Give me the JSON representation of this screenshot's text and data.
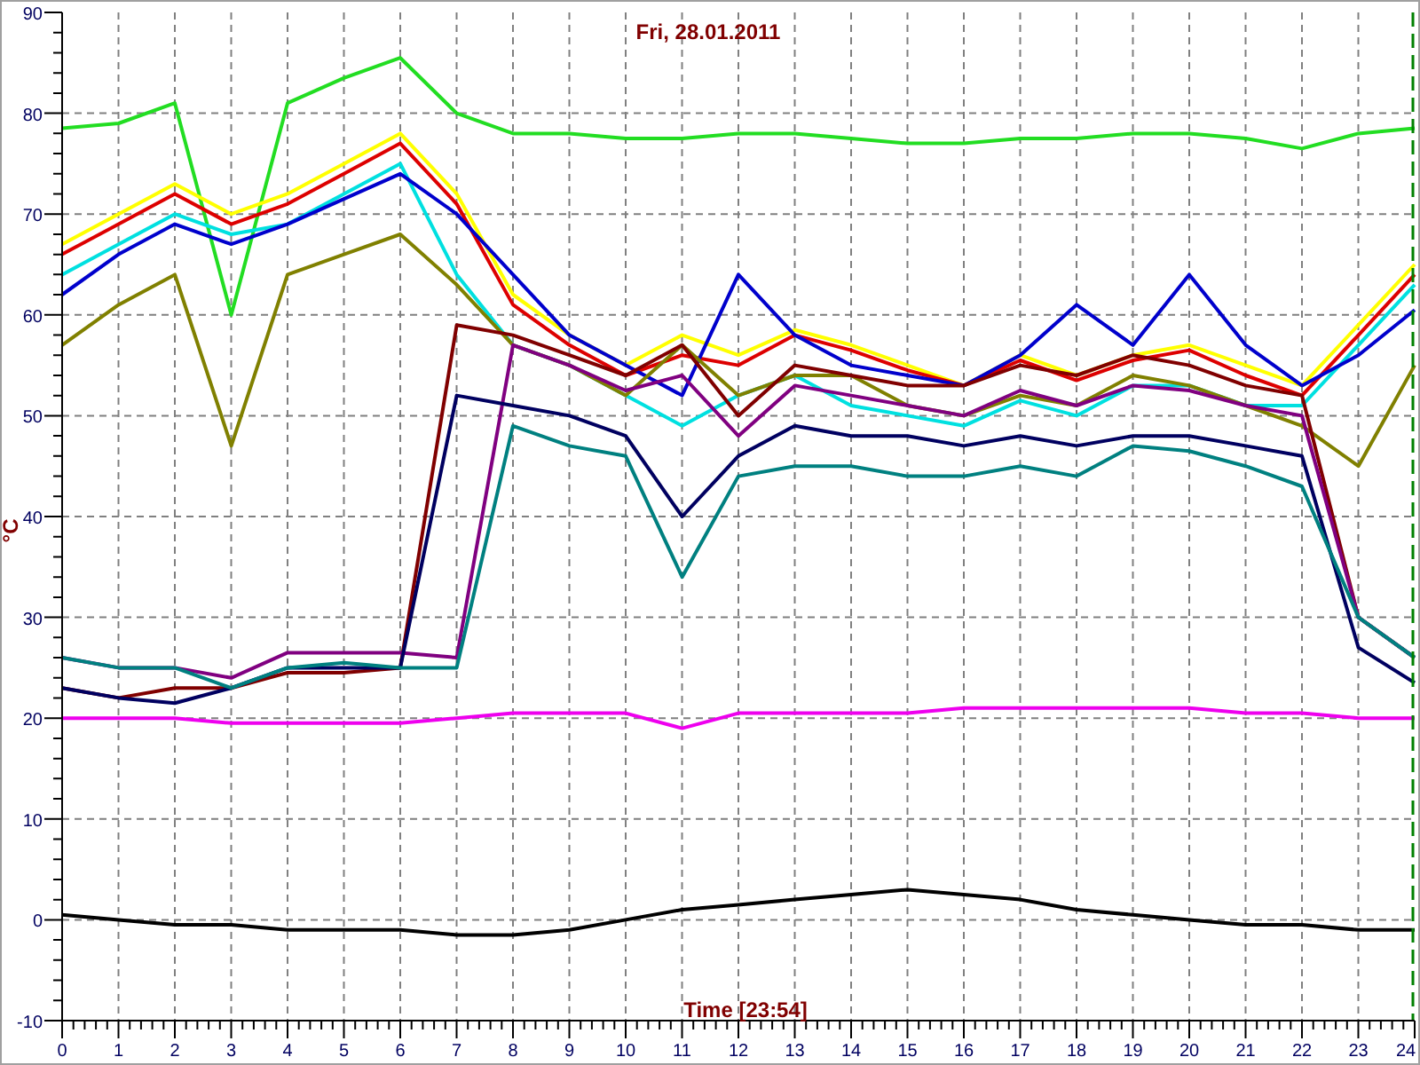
{
  "chart": {
    "chart_data": {
      "type": "line",
      "title": "Fri, 28.01.2011",
      "xlabel": "Time [23:54]",
      "ylabel": "°C",
      "x": [
        0,
        1,
        2,
        3,
        4,
        5,
        6,
        7,
        8,
        9,
        10,
        11,
        12,
        13,
        14,
        15,
        16,
        17,
        18,
        19,
        20,
        21,
        22,
        23,
        24
      ],
      "xlim": [
        0,
        24
      ],
      "ylim": [
        -10,
        90
      ],
      "xticks": [
        0,
        1,
        2,
        3,
        4,
        5,
        6,
        7,
        8,
        9,
        10,
        11,
        12,
        13,
        14,
        15,
        16,
        17,
        18,
        19,
        20,
        21,
        22,
        23,
        24
      ],
      "yticks": [
        -10,
        0,
        10,
        20,
        30,
        40,
        50,
        60,
        70,
        80,
        90
      ],
      "series": [
        {
          "color": "#22dd22",
          "values": [
            78.5,
            79,
            81,
            60,
            81,
            83.5,
            85.5,
            80,
            78,
            78,
            77.5,
            77.5,
            78,
            78,
            77.5,
            77,
            77,
            77.5,
            77.5,
            78,
            78,
            77.5,
            76.5,
            78,
            78.5
          ]
        },
        {
          "color": "#ffff00",
          "values": [
            67,
            70,
            73,
            70,
            72,
            75,
            78,
            72,
            62,
            58,
            55,
            58,
            56,
            58.5,
            57,
            55,
            53,
            56,
            54,
            56,
            57,
            55,
            53,
            59,
            65
          ]
        },
        {
          "color": "#dd0000",
          "values": [
            66,
            69,
            72,
            69,
            71,
            74,
            77,
            71,
            61,
            57,
            54,
            56,
            55,
            58,
            56.5,
            54.5,
            53,
            55.5,
            53.5,
            55.5,
            56.5,
            54,
            52,
            58,
            64
          ]
        },
        {
          "color": "#00e0e0",
          "values": [
            64,
            67,
            70,
            68,
            69,
            72,
            75,
            64,
            57,
            55,
            52,
            49,
            52,
            54,
            51,
            50,
            49,
            51.5,
            50,
            53,
            53,
            51,
            51,
            57,
            63
          ]
        },
        {
          "color": "#0000cc",
          "values": [
            62,
            66,
            69,
            67,
            69,
            71.5,
            74,
            70,
            64,
            58,
            55,
            52,
            64,
            58,
            55,
            54,
            53,
            56,
            61,
            57,
            64,
            57,
            53,
            56,
            60.5
          ]
        },
        {
          "color": "#808000",
          "values": [
            57,
            61,
            64,
            47,
            64,
            66,
            68,
            63,
            57,
            55,
            52,
            57,
            52,
            54,
            54,
            51,
            50,
            52,
            51,
            54,
            53,
            51,
            49,
            45,
            55
          ]
        },
        {
          "color": "#800000",
          "values": [
            23,
            22,
            23,
            23,
            24.5,
            24.5,
            25,
            59,
            58,
            56,
            54,
            57,
            50,
            55,
            54,
            53,
            53,
            55,
            54,
            56,
            55,
            53,
            52,
            30,
            26
          ]
        },
        {
          "color": "#800080",
          "values": [
            26,
            25,
            25,
            24,
            26.5,
            26.5,
            26.5,
            26,
            57,
            55,
            52.5,
            54,
            48,
            53,
            52,
            51,
            50,
            52.5,
            51,
            53,
            52.5,
            51,
            50,
            30,
            26
          ]
        },
        {
          "color": "#000060",
          "values": [
            23,
            22,
            21.5,
            23,
            25,
            25,
            25,
            52,
            51,
            50,
            48,
            40,
            46,
            49,
            48,
            48,
            47,
            48,
            47,
            48,
            48,
            47,
            46,
            27,
            23.5
          ]
        },
        {
          "color": "#008080",
          "values": [
            26,
            25,
            25,
            23,
            25,
            25.5,
            25,
            25,
            49,
            47,
            46,
            34,
            44,
            45,
            45,
            44,
            44,
            45,
            44,
            47,
            46.5,
            45,
            43,
            30,
            26
          ]
        },
        {
          "color": "#ee00ee",
          "values": [
            20,
            20,
            20,
            19.5,
            19.5,
            19.5,
            19.5,
            20,
            20.5,
            20.5,
            20.5,
            19,
            20.5,
            20.5,
            20.5,
            20.5,
            21,
            21,
            21,
            21,
            21,
            20.5,
            20.5,
            20,
            20
          ]
        },
        {
          "color": "#000000",
          "values": [
            0.5,
            0,
            -0.5,
            -0.5,
            -1,
            -1,
            -1,
            -1.5,
            -1.5,
            -1,
            0,
            1,
            1.5,
            2,
            2.5,
            3,
            2.5,
            2,
            1,
            0.5,
            0,
            -0.5,
            -0.5,
            -1,
            -1
          ]
        }
      ],
      "grid": true
    }
  }
}
